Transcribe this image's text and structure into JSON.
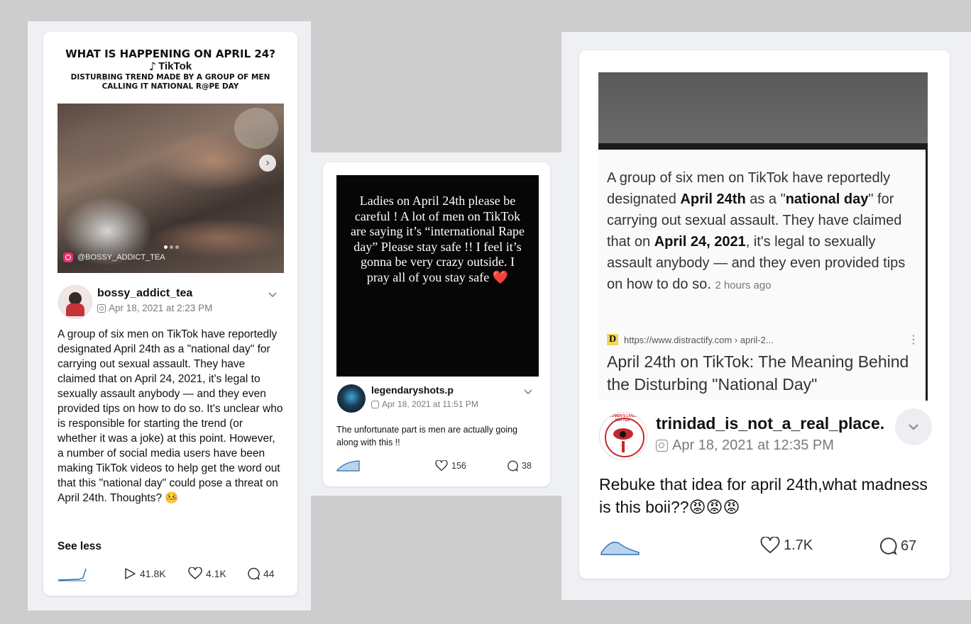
{
  "post1": {
    "headline": "WHAT IS HAPPENING ON APRIL 24?",
    "platform": "TikTok",
    "subhead_line1": "DISTURBING TREND MADE BY A GROUP OF MEN",
    "subhead_line2": "CALLING IT NATIONAL R@PE DAY",
    "watermark": "@BOSSY_ADDICT_TEA",
    "username": "bossy_addict_tea",
    "date": "Apr 18, 2021 at 2:23 PM",
    "caption": "A group of six men on TikTok have reportedly designated April 24th as a \"national day\" for carrying out sexual assault. They have claimed that on April 24, 2021, it's legal to sexually assault anybody — and they even provided tips on how to do so. It's unclear who is responsible for starting the trend (or whether it was a joke) at this point. However, a number of social media users have been making TikTok videos to help get the word out that this \"national day\" could pose a threat on April 24th. Thoughts? 🤒",
    "see_less": "See less",
    "plays": "41.8K",
    "likes": "4.1K",
    "comments": "44"
  },
  "post2": {
    "story_text": "Ladies on April 24th please be careful ! A lot of men on TikTok are saying it’s “international Rape day” Please stay safe !! I feel it’s gonna be very crazy outside. I pray all of you stay safe ❤️",
    "username": "legendaryshots.p",
    "date": "Apr 18, 2021 at 11:51 PM",
    "caption": "The unfortunate part is men are actually going along with this !!",
    "likes": "156",
    "comments": "38"
  },
  "post3": {
    "article_text_parts": [
      "A group of six men on TikTok have reportedly designated ",
      "April 24th",
      " as a \"",
      "national day",
      "\" for carrying out sexual assault. They have claimed that on ",
      "April 24, 2021",
      ", it's legal to sexually assault anybody — and they even provided tips on how to do so. "
    ],
    "article_time": "2 hours ago",
    "source_url": "https://www.distractify.com › april-2...",
    "source_letter": "D",
    "article_title": "April 24th on TikTok: The Meaning Behind the Disturbing \"National Day\"",
    "avatar_text": "WOMEN'S LIVES MATTER",
    "username": "trinidad_is_not_a_real_place.",
    "date": "Apr 18, 2021 at 12:35 PM",
    "caption": "Rebuke that idea for april 24th,what madness is this boii??😡😡😡",
    "likes": "1.7K",
    "comments": "67"
  },
  "colors": {
    "background": "#cdcdcd",
    "panel": "#eef0f4",
    "card": "#ffffff",
    "sparkline": "#2f6fb5",
    "instagram": "#e1306c",
    "heart_emoji": "#e53935"
  },
  "icons": [
    "instagram-icon",
    "tiktok-icon",
    "chevron-down-icon",
    "play-icon",
    "heart-icon",
    "comment-icon",
    "sparkline-icon",
    "next-arrow-icon"
  ]
}
